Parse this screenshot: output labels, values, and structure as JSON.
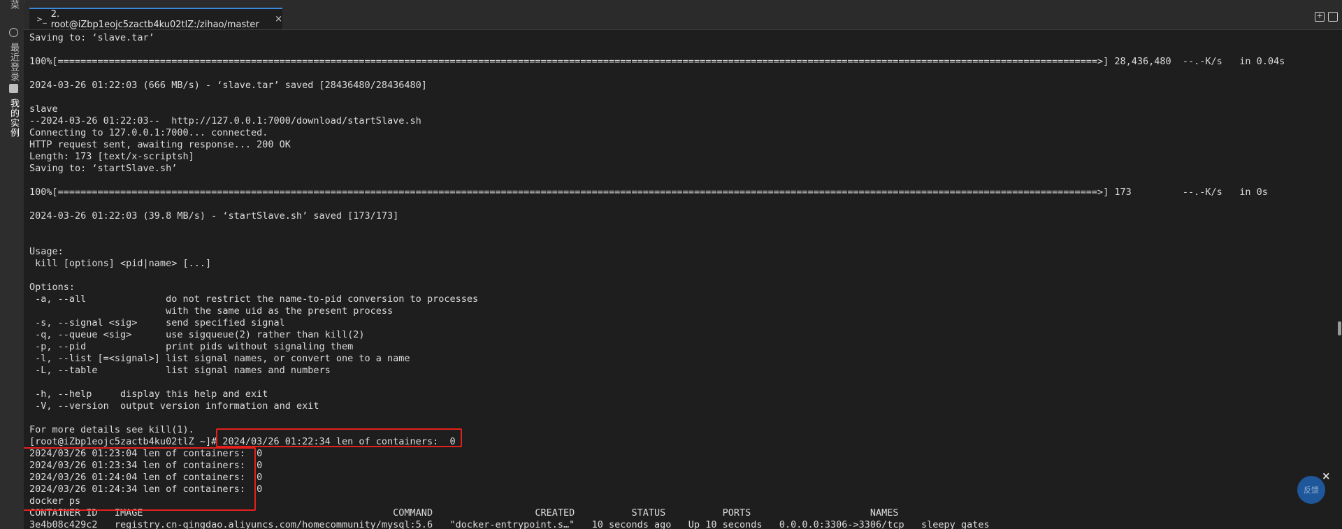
{
  "left_rail": {
    "items": [
      {
        "label": "菜"
      },
      {
        "label": "最近登录"
      },
      {
        "label": "我的实例"
      }
    ]
  },
  "tab": {
    "prompt_icon": ">_",
    "title": "2. root@iZbp1eojc5zactb4ku02tlZ:/zihao/master",
    "close": "×"
  },
  "toolbar": {
    "new_tab": "+",
    "maximize": "□"
  },
  "terminal": {
    "lines": [
      "Saving to: ‘slave.tar’",
      "",
      "100%[=======================================================================================================================================================================================>] 28,436,480  --.-K/s   in 0.04s",
      "",
      "2024-03-26 01:22:03 (666 MB/s) - ‘slave.tar’ saved [28436480/28436480]",
      "",
      "slave",
      "--2024-03-26 01:22:03--  http://127.0.0.1:7000/download/startSlave.sh",
      "Connecting to 127.0.0.1:7000... connected.",
      "HTTP request sent, awaiting response... 200 OK",
      "Length: 173 [text/x-scriptsh]",
      "Saving to: ‘startSlave.sh’",
      "",
      "100%[=======================================================================================================================================================================================>] 173         --.-K/s   in 0s",
      "",
      "2024-03-26 01:22:03 (39.8 MB/s) - ‘startSlave.sh’ saved [173/173]",
      "",
      "",
      "Usage:",
      " kill [options] <pid|name> [...]",
      "",
      "Options:",
      " -a, --all              do not restrict the name-to-pid conversion to processes",
      "                        with the same uid as the present process",
      " -s, --signal <sig>     send specified signal",
      " -q, --queue <sig>      use sigqueue(2) rather than kill(2)",
      " -p, --pid              print pids without signaling them",
      " -l, --list [=<signal>] list signal names, or convert one to a name",
      " -L, --table            list signal names and numbers",
      "",
      " -h, --help     display this help and exit",
      " -V, --version  output version information and exit",
      "",
      "For more details see kill(1).",
      "[root@iZbp1eojc5zactb4ku02tlZ ~]# 2024/03/26 01:22:34 len of containers:  0",
      "2024/03/26 01:23:04 len of containers:  0",
      "2024/03/26 01:23:34 len of containers:  0",
      "2024/03/26 01:24:04 len of containers:  0",
      "2024/03/26 01:24:34 len of containers:  0",
      "docker ps",
      "CONTAINER ID   IMAGE                                            COMMAND                  CREATED          STATUS          PORTS                     NAMES",
      "3e4b08c429c2   registry.cn-qingdao.aliyuncs.com/homecommunity/mysql:5.6   \"docker-entrypoint.s…\"   10 seconds ago   Up 10 seconds   0.0.0.0:3306->3306/tcp   sleepy_gates"
    ]
  },
  "feedback": {
    "label": "反馈",
    "close": "×"
  },
  "colors": {
    "highlight_box": "#e3211c",
    "terminal_bg": "#1e1e1e",
    "terminal_fg": "#dcdcdc",
    "tab_accent": "#3b8ad9"
  }
}
